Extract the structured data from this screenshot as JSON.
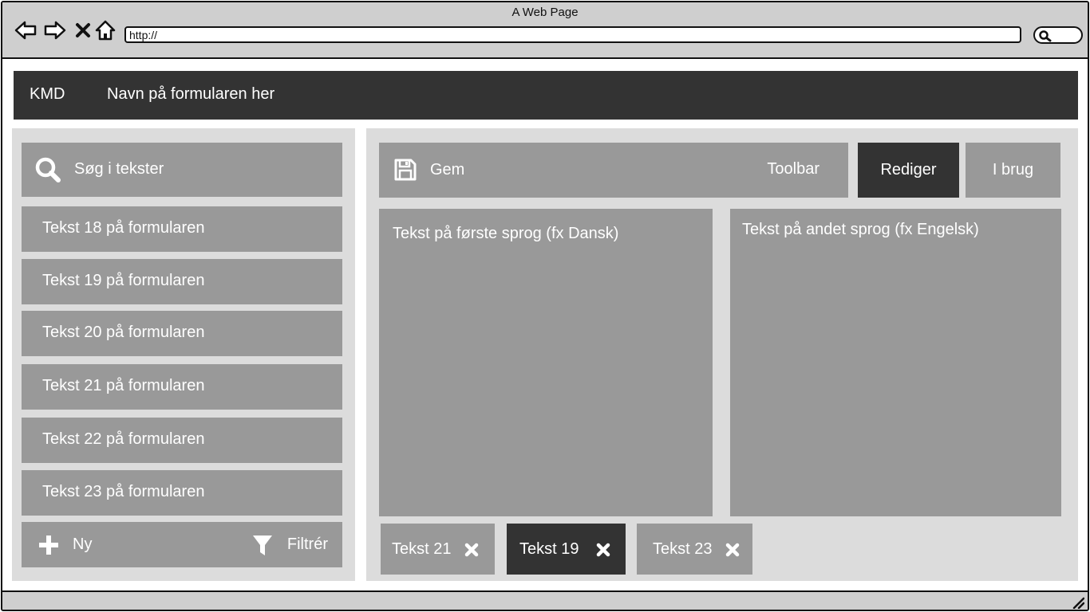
{
  "browser": {
    "window_title": "A Web Page",
    "address": "http://",
    "icons": {
      "back": "arrow-left-icon",
      "forward": "arrow-right-icon",
      "stop": "close-icon",
      "home": "home-icon",
      "search": "search-icon",
      "resize": "resize-grip-icon"
    }
  },
  "header": {
    "logo": "KMD",
    "form_title": "Navn på formularen her"
  },
  "sidebar": {
    "search": {
      "label": "Søg i tekster",
      "icon": "search-icon"
    },
    "items": [
      {
        "label": "Tekst 18 på formularen"
      },
      {
        "label": "Tekst 19 på formularen"
      },
      {
        "label": "Tekst 20 på formularen"
      },
      {
        "label": "Tekst 21 på formularen"
      },
      {
        "label": "Tekst 22 på formularen"
      },
      {
        "label": "Tekst 23 på formularen"
      }
    ],
    "actions": {
      "new_label": "Ny",
      "new_icon": "plus-icon",
      "filter_label": "Filtrér",
      "filter_icon": "funnel-icon"
    }
  },
  "main": {
    "toolbar": {
      "save_label": "Gem",
      "save_icon": "floppy-disk-icon",
      "label": "Toolbar"
    },
    "tabs": [
      {
        "label": "Rediger",
        "active": true
      },
      {
        "label": "I brug",
        "active": false
      }
    ],
    "editors": {
      "primary_label": "Tekst på første sprog (fx Dansk)",
      "secondary_label": "Tekst på andet sprog (fx Engelsk)"
    },
    "open_tabs": [
      {
        "label": "Tekst 21",
        "active": false
      },
      {
        "label": "Tekst 19",
        "active": true
      },
      {
        "label": "Tekst 23",
        "active": false
      }
    ]
  },
  "colors": {
    "chrome": "#cfcfcf",
    "dark": "#333333",
    "panel": "#dcdcdc",
    "box": "#999999",
    "text_light": "#ffffff"
  }
}
